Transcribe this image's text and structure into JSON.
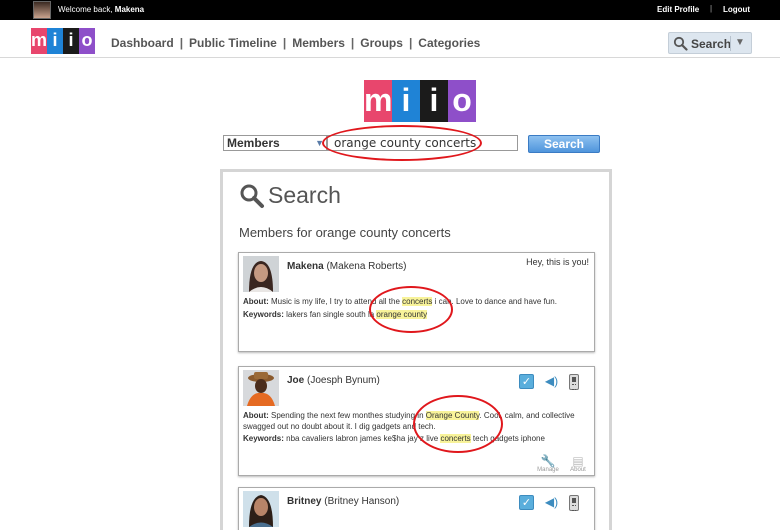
{
  "topbar": {
    "welcome_prefix": "Welcome back,",
    "user_name": "Makena",
    "edit_profile": "Edit Profile",
    "separator": "|",
    "logout": "Logout"
  },
  "brand": {
    "letters": [
      "m",
      "i",
      "i",
      "o"
    ],
    "colors": [
      "#e8466d",
      "#1f83d6",
      "#1b1b1b",
      "#8e4fc9"
    ]
  },
  "nav": {
    "links": [
      "Dashboard",
      "Public Timeline",
      "Members",
      "Groups",
      "Categories"
    ],
    "separator": "|",
    "search_button": "Search"
  },
  "search": {
    "scope": "Members",
    "query": "orange county concerts",
    "submit": "Search"
  },
  "results": {
    "title": "Search",
    "heading": "Members for orange county concerts",
    "members": [
      {
        "username": "Makena",
        "fullname": "(Makena Roberts)",
        "status": "Hey, this is you!",
        "about_label": "About:",
        "about_pre": " Music is my life, I try to attend all the ",
        "about_hl": "concerts",
        "about_post": " i can. Love to dance and have fun.",
        "keywords_label": "Keywords:",
        "keywords_pre": " lakers fan single south la ",
        "keywords_hl": "orange county",
        "keywords_post": ""
      },
      {
        "username": "Joe",
        "fullname": "(Joesph Bynum)",
        "about_label": "About:",
        "about_pre": " Spending the next few monthes studying in ",
        "about_hl": "Orange County",
        "about_post": ". Cool, calm, and collective swagged out no doubt about it. I dig gadgets and tech.",
        "keywords_label": "Keywords:",
        "keywords_pre": " nba cavaliers labron james ke$ha jay z live ",
        "keywords_hl": "concerts",
        "keywords_post": " tech gadgets iphone",
        "actions": [
          "Manage",
          "About"
        ]
      },
      {
        "username": "Britney",
        "fullname": "(Britney Hanson)"
      }
    ]
  },
  "icons": {
    "search": "magnifier-icon",
    "follow": "checkbox-icon",
    "audio": "speaker-icon",
    "mobile": "phone-icon",
    "manage": "wrench-icon",
    "about": "id-card-icon"
  },
  "colors": {
    "highlight": "#f8f39a",
    "annotation": "#e0171c",
    "accent": "#4f95dc"
  }
}
